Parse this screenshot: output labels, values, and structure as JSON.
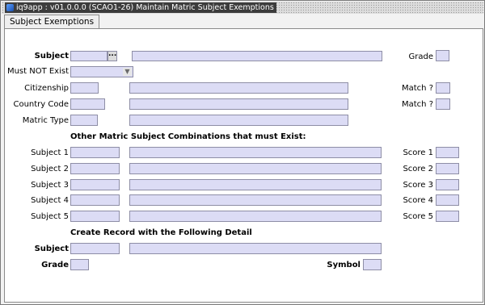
{
  "window": {
    "title": "iq9app : v01.0.0.0 (SCAO1-26) Maintain Matric Subject Exemptions"
  },
  "tabs": [
    {
      "label": "Subject Exemptions"
    }
  ],
  "form": {
    "subject_label": "Subject",
    "subject_code": "",
    "subject_desc": "",
    "grade_label": "Grade",
    "grade": "",
    "must_not_exist_label": "Must NOT Exist",
    "must_not_exist_value": "",
    "citizenship_label": "Citizenship",
    "citizenship_code": "",
    "citizenship_desc": "",
    "match1_label": "Match ?",
    "match1": "",
    "country_label": "Country Code",
    "country_code": "",
    "country_desc": "",
    "match2_label": "Match ?",
    "match2": "",
    "matric_type_label": "Matric Type",
    "matric_type_code": "",
    "matric_type_desc": "",
    "combos_heading": "Other Matric Subject Combinations that must Exist:",
    "combos": [
      {
        "label": "Subject 1",
        "code": "",
        "desc": "",
        "score_label": "Score 1",
        "score": ""
      },
      {
        "label": "Subject 2",
        "code": "",
        "desc": "",
        "score_label": "Score 2",
        "score": ""
      },
      {
        "label": "Subject 3",
        "code": "",
        "desc": "",
        "score_label": "Score 3",
        "score": ""
      },
      {
        "label": "Subject 4",
        "code": "",
        "desc": "",
        "score_label": "Score 4",
        "score": ""
      },
      {
        "label": "Subject 5",
        "code": "",
        "desc": "",
        "score_label": "Score 5",
        "score": ""
      }
    ],
    "create_heading": "Create Record with the Following Detail",
    "create_subject_label": "Subject",
    "create_subject_code": "",
    "create_subject_desc": "",
    "create_grade_label": "Grade",
    "create_grade": "",
    "symbol_label": "Symbol",
    "symbol": ""
  }
}
